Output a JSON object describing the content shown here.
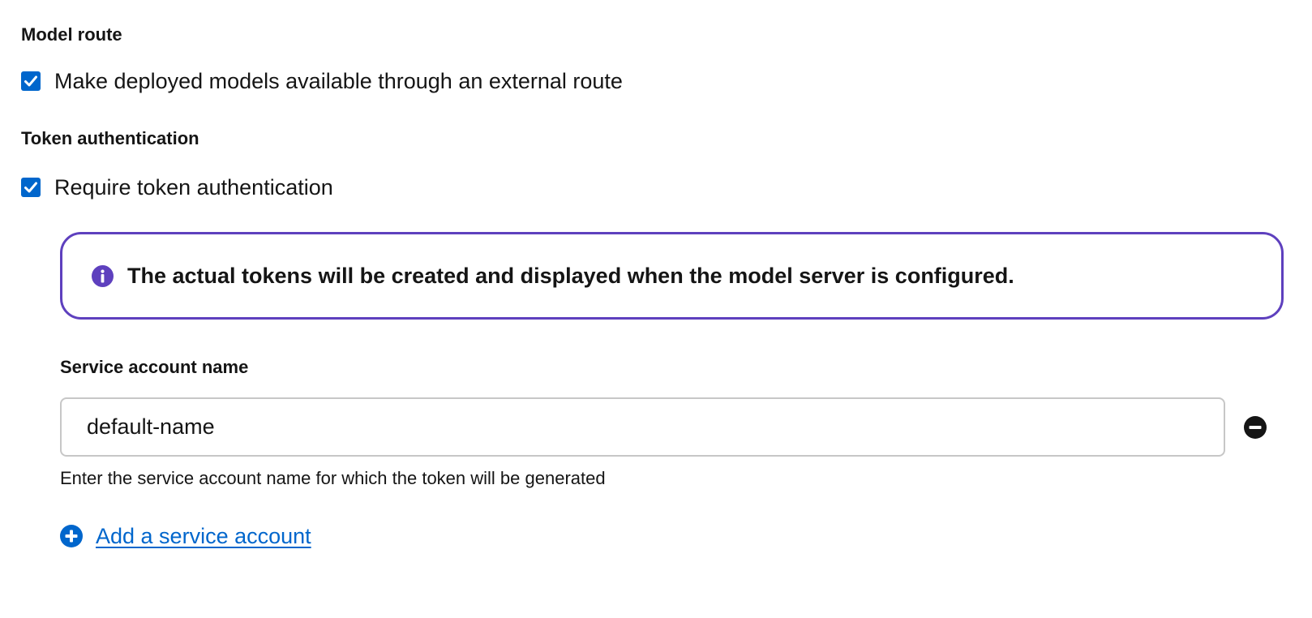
{
  "model_route": {
    "heading": "Model route",
    "checkbox_label": "Make deployed models available through an external route",
    "checked": true
  },
  "token_auth": {
    "heading": "Token authentication",
    "checkbox_label": "Require token authentication",
    "checked": true,
    "alert": {
      "icon": "info-circle-icon",
      "text": "The actual tokens will be created and displayed when the model server is configured."
    },
    "service_account": {
      "label": "Service account name",
      "value": "default-name",
      "helper": "Enter the service account name for which the token will be generated",
      "remove_icon": "minus-circle-icon"
    },
    "add_link": {
      "icon": "plus-circle-icon",
      "label": "Add a service account"
    }
  },
  "colors": {
    "checkbox": "#0066cc",
    "alert_border": "#5e40be",
    "link": "#0066cc",
    "input_border": "#c7c7c7"
  }
}
